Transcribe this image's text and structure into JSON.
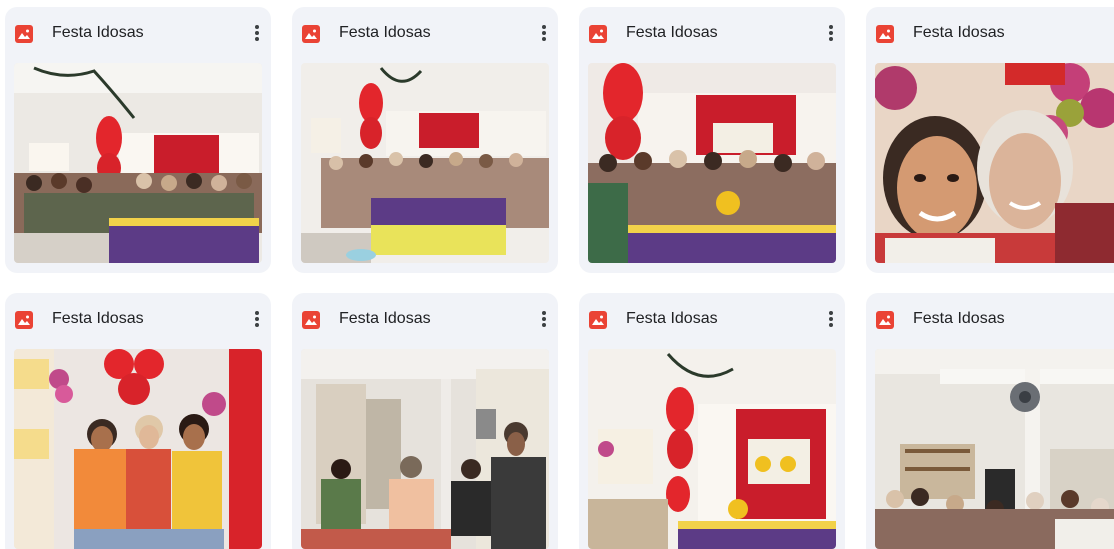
{
  "files": [
    {
      "title": "Festa Idosas",
      "icon": "image-file-icon",
      "menu_icon": "more-vert-icon"
    },
    {
      "title": "Festa Idosas",
      "icon": "image-file-icon",
      "menu_icon": "more-vert-icon"
    },
    {
      "title": "Festa Idosas",
      "icon": "image-file-icon",
      "menu_icon": "more-vert-icon"
    },
    {
      "title": "Festa Idosas",
      "icon": "image-file-icon",
      "menu_icon": "more-vert-icon"
    },
    {
      "title": "Festa Idosas",
      "icon": "image-file-icon",
      "menu_icon": "more-vert-icon"
    },
    {
      "title": "Festa Idosas",
      "icon": "image-file-icon",
      "menu_icon": "more-vert-icon"
    },
    {
      "title": "Festa Idosas",
      "icon": "image-file-icon",
      "menu_icon": "more-vert-icon"
    },
    {
      "title": "Festa Idosas",
      "icon": "image-file-icon",
      "menu_icon": "more-vert-icon"
    }
  ],
  "colors": {
    "card_bg": "#f1f3f8",
    "icon_red": "#ea4335",
    "text": "#202124"
  }
}
